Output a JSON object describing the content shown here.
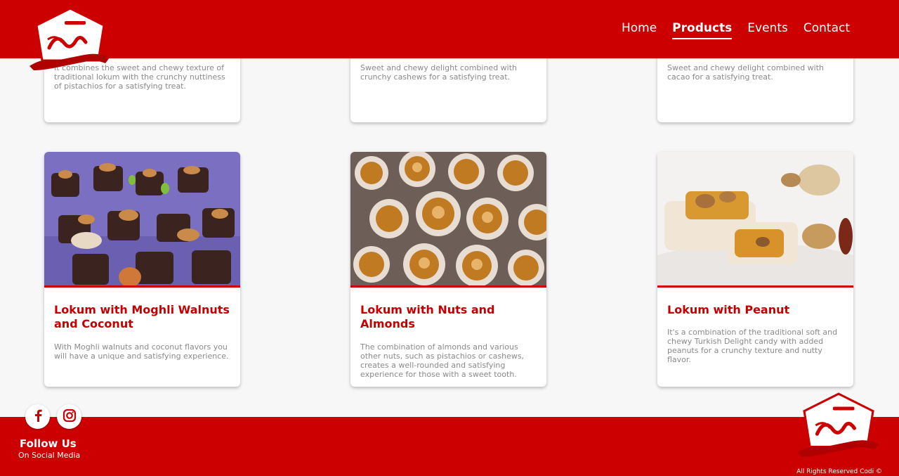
{
  "nav": {
    "items": [
      "Home",
      "Products",
      "Events",
      "Contact"
    ],
    "active": "Products"
  },
  "colors": {
    "brand_red": "#cc0000",
    "title_red": "#c40000",
    "text_gray": "#8a8a8a"
  },
  "products_top": [
    {
      "description": "It combines the sweet and chewy texture of traditional lokum with the crunchy nuttiness of pistachios for a satisfying treat."
    },
    {
      "description": "Sweet and chewy delight combined with crunchy cashews for a satisfying treat."
    },
    {
      "description": "Sweet and chewy delight combined with cacao for a satisfying treat."
    }
  ],
  "products": [
    {
      "title": "Lokum with Moghli Walnuts and Coconut",
      "description": "With Moghli walnuts and coconut flavors you will have a unique and satisfying experience."
    },
    {
      "title": "Lokum with Nuts and Almonds",
      "description": "The combination of almonds and various other nuts, such as pistachios or cashews, creates a well-rounded and satisfying experience for those with a sweet tooth."
    },
    {
      "title": "Lokum with Peanut",
      "description": "It's a combination of the traditional soft and chewy Turkish Delight candy with added peanuts for a crunchy texture and nutty flavor."
    }
  ],
  "footer": {
    "follow_title": "Follow Us",
    "follow_subtitle": "On Social Media",
    "social": [
      "facebook-icon",
      "instagram-icon"
    ],
    "rights": "All Rights Reserved Codi ©"
  }
}
